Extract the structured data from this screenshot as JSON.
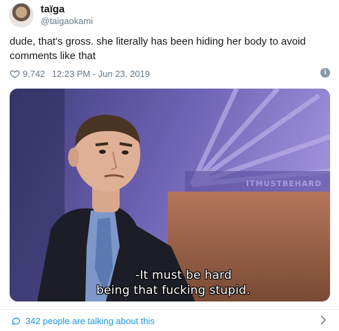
{
  "user": {
    "display_name": "taïga",
    "handle": "@taigaokami"
  },
  "tweet": {
    "text": "dude, that's gross. she literally has been hiding her body to avoid comments like that",
    "like_count": "9,742",
    "timestamp": "12:23 PM - Jun 23, 2019"
  },
  "media": {
    "watermark": "ITMUSTBEHARD",
    "caption_line1": "-It must be hard",
    "caption_line2": "being that fucking stupid."
  },
  "footer": {
    "talking_text": "342 people are talking about this"
  },
  "colors": {
    "link": "#1b95e0",
    "secondary": "#657786",
    "text": "#14171a"
  },
  "icons": {
    "like": "heart-outline-icon",
    "info": "info-icon",
    "reply": "speech-bubble-icon",
    "more": "chevron-right-icon"
  }
}
